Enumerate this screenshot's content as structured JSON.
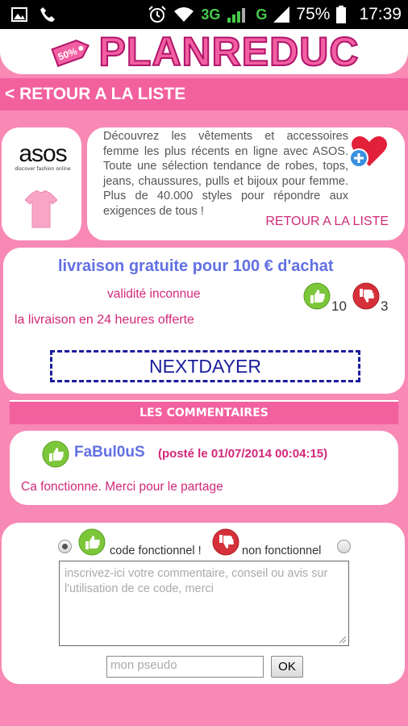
{
  "status_bar": {
    "network": "3G",
    "network2": "G",
    "battery": "75%",
    "time": "17:39",
    "icons": [
      "image-icon",
      "phone-icon",
      "alarm-icon",
      "wifi-icon",
      "signal-icon",
      "battery-icon"
    ]
  },
  "header": {
    "logo_text": "PLANREDUC",
    "tag_text": "50%"
  },
  "nav": {
    "back_label": "< RETOUR A LA LISTE"
  },
  "store": {
    "brand": "asos",
    "brand_tagline": "discover fashion online",
    "description": "Découvrez les vêtements et accessoires femme les plus récents en ligne avec ASOS. Toute une sélection tendance de robes, tops, jeans, chaussures, pulls et bijoux pour femme. Plus de 40.000 styles pour répondre aux exigences de tous !",
    "back_link": "RETOUR A LA LISTE"
  },
  "offer": {
    "title": "livraison gratuite pour 100 € d'achat",
    "validity": "validité inconnue",
    "subtitle": "la livraison en 24 heures offerte",
    "votes_up": "10",
    "votes_down": "3",
    "code": "NEXTDAYER"
  },
  "comments": {
    "header": "LES COMMENTAIRES",
    "items": [
      {
        "author": "FaBul0uS",
        "date": "(posté le 01/07/2014 00:04:15)",
        "text": "Ca fonctionne. Merci pour le partage"
      }
    ]
  },
  "form": {
    "option_working": "code fonctionnel !",
    "option_not_working": "non fonctionnel",
    "comment_placeholder": "inscrivez-ici votre commentaire, conseil ou avis sur l'utilisation de ce code, merci",
    "pseudo_placeholder": "mon pseudo",
    "submit_label": "OK"
  },
  "colors": {
    "background": "#f889b4",
    "accent": "#f2609e",
    "title_blue": "#6270e3",
    "text_pink": "#d3287a",
    "code_blue": "#1a1d9c"
  }
}
